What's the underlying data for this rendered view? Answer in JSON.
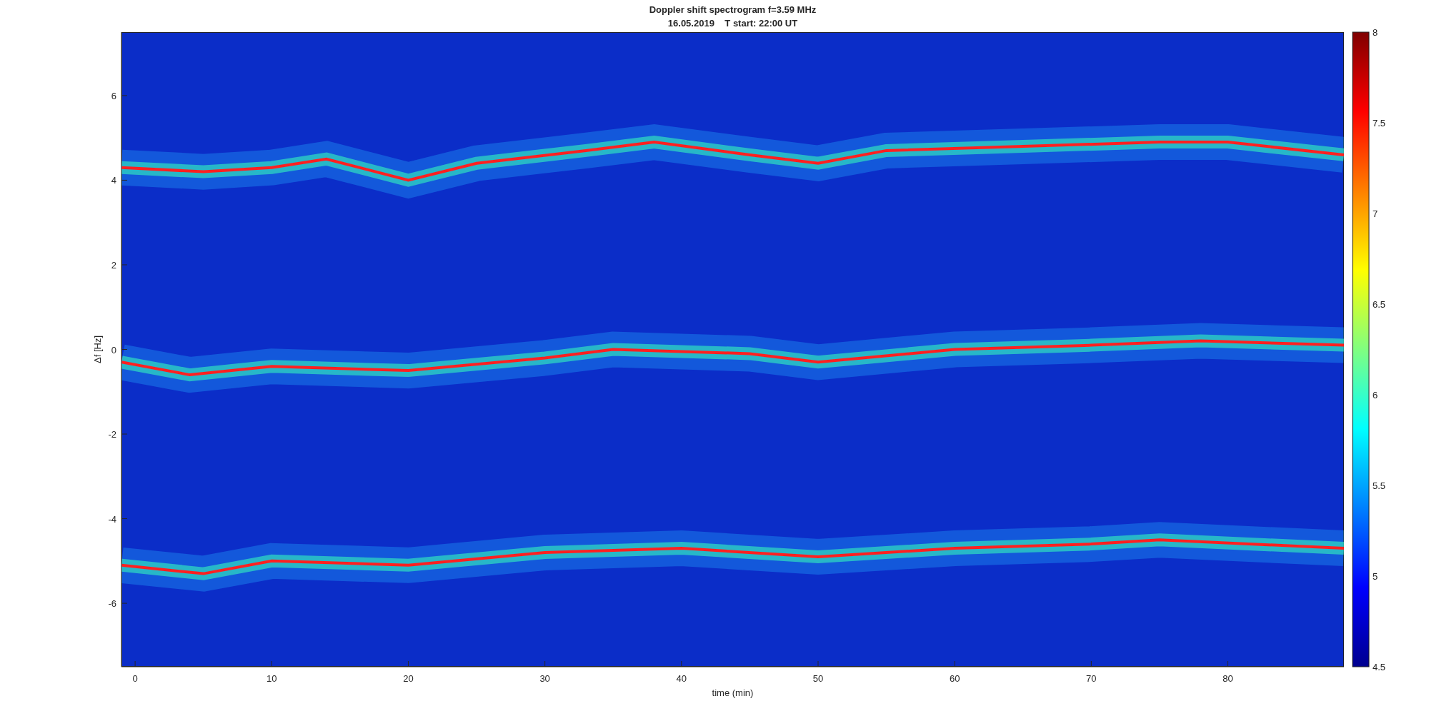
{
  "figure": {
    "title_lines": [
      "Doppler shift spectrogram f=3.59 MHz",
      "16.05.2019    T start: 22:00 UT"
    ],
    "xlabel": "time (min)",
    "ylabel": "Δf [Hz]",
    "xticks": [
      "0",
      "10",
      "20",
      "30",
      "40",
      "50",
      "60",
      "70",
      "80"
    ],
    "yticks": [
      "6",
      "4",
      "2",
      "0",
      "-2",
      "-4",
      "-6"
    ],
    "colorbar": {
      "ticks": [
        "8",
        "7.5",
        "7",
        "6.5",
        "6",
        "5.5",
        "5",
        "4.5"
      ]
    }
  }
}
